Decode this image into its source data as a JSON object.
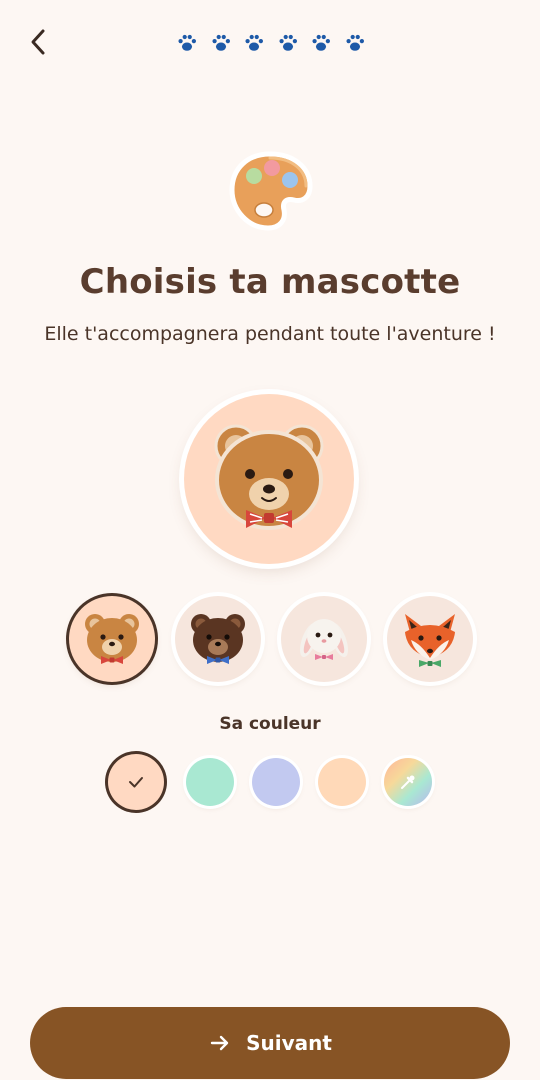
{
  "progress": {
    "steps_total": 6,
    "steps_done": 6,
    "color": "#1e5aa8"
  },
  "header": {
    "title": "Choisis ta mascotte",
    "subtitle": "Elle t'accompagnera pendant toute l'aventure !"
  },
  "mascots": [
    {
      "name": "bear-light-icon",
      "selected": true
    },
    {
      "name": "bear-dark-icon",
      "selected": false
    },
    {
      "name": "bunny-icon",
      "selected": false
    },
    {
      "name": "fox-icon",
      "selected": false
    }
  ],
  "colors": {
    "label": "Sa couleur",
    "swatches": [
      "#ffd9c2",
      "#a9e8d2",
      "#c2c9f0",
      "#ffd9b8",
      "custom-picker"
    ],
    "selected_index": 0
  },
  "footer": {
    "next_label": "Suivant"
  },
  "theme": {
    "primary": "#875425",
    "text": "#4a3428",
    "background": "#fdf7f3"
  }
}
